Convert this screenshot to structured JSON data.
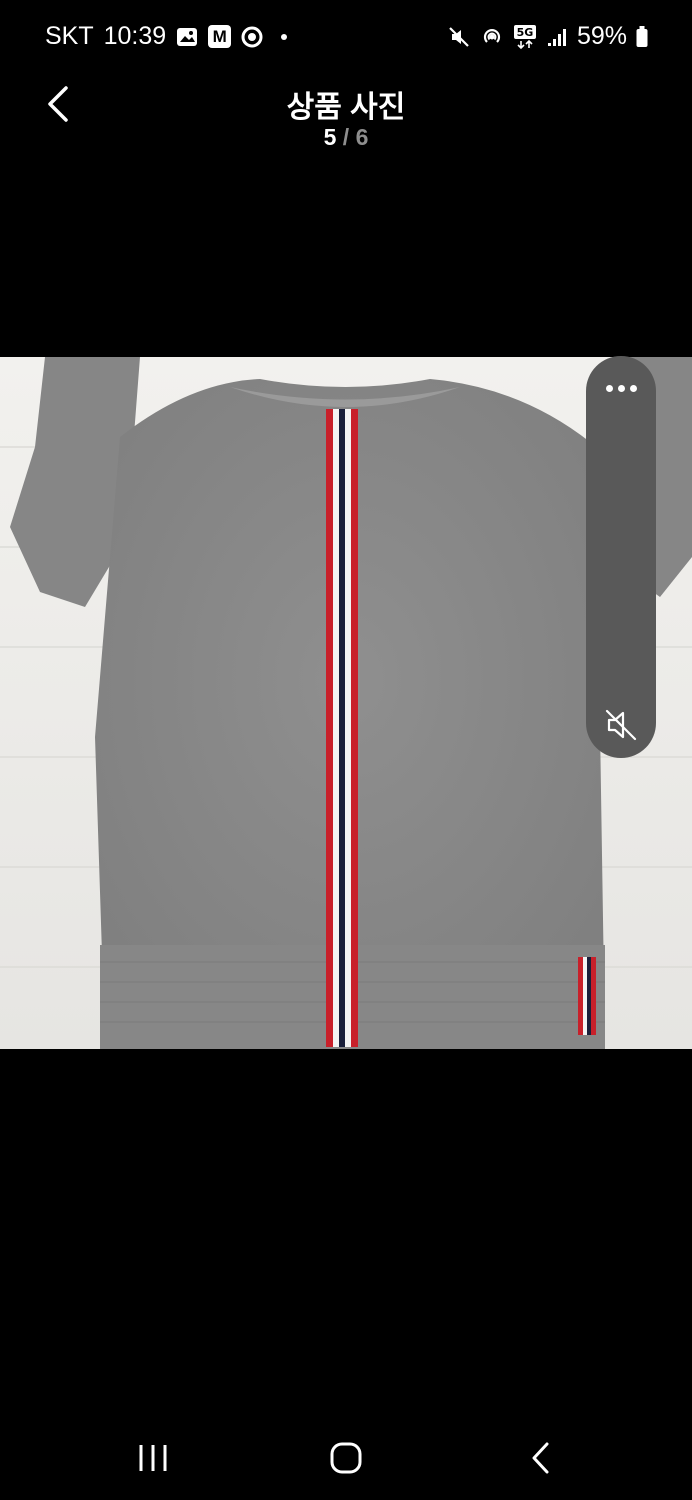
{
  "status_bar": {
    "carrier": "SKT",
    "time": "10:39",
    "m_badge": "M",
    "network": "5G",
    "battery": "59%",
    "left_icons": [
      "gallery-icon",
      "m-badge-icon",
      "chrome-icon",
      "notification-dot-icon"
    ],
    "right_icons": [
      "mute-icon",
      "hotspot-icon",
      "5g-icon",
      "signal-icon",
      "battery-icon"
    ]
  },
  "header": {
    "title": "상품 사진",
    "current": "5",
    "separator": "/",
    "total": "6"
  },
  "photo": {
    "stripe_colors": [
      "#c8202a",
      "#f4f4f4",
      "#1a1f3a"
    ],
    "fabric_color": "#8c8c8c"
  },
  "edge_panel": {
    "icons": [
      "more-icon",
      "mute-icon"
    ]
  },
  "nav_bar": {
    "icons": [
      "recents-icon",
      "home-icon",
      "back-icon"
    ]
  }
}
